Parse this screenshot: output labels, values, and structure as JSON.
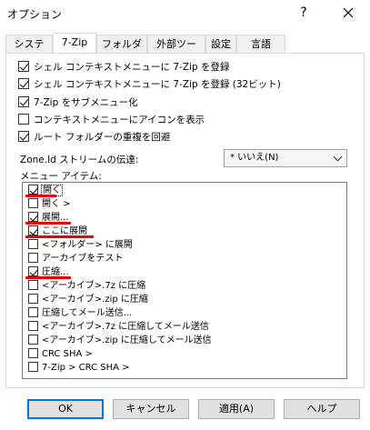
{
  "window": {
    "title": "オプション",
    "help_symbol": "?"
  },
  "tabs": [
    {
      "label": "システム",
      "active": false
    },
    {
      "label": "7-Zip",
      "active": true
    },
    {
      "label": "フォルダー",
      "active": false
    },
    {
      "label": "外部ツール",
      "active": false
    },
    {
      "label": "設定",
      "active": false
    },
    {
      "label": "言語",
      "active": false
    }
  ],
  "options": [
    {
      "label": "シェル コンテキストメニューに 7-Zip を登録",
      "checked": true
    },
    {
      "label": "シェル コンテキストメニューに 7-Zip を登録 (32ビット)",
      "checked": true
    },
    {
      "label": "7-Zip をサブメニュー化",
      "checked": true
    },
    {
      "label": "コンテキストメニューにアイコンを表示",
      "checked": false
    },
    {
      "label": "ルート フォルダーの重複を回避",
      "checked": true
    }
  ],
  "zone": {
    "label": "Zone.Id ストリームの伝達:",
    "value": "* いいえ(N)"
  },
  "menu_items_label": "メニュー アイテム:",
  "menu_items": [
    {
      "label": "開く",
      "checked": true
    },
    {
      "label": "開く >",
      "checked": false
    },
    {
      "label": "展開...",
      "checked": true
    },
    {
      "label": "ここに展開",
      "checked": true
    },
    {
      "label": "<フォルダー> に展開",
      "checked": false
    },
    {
      "label": "アーカイブをテスト",
      "checked": false
    },
    {
      "label": "圧縮...",
      "checked": true
    },
    {
      "label": "<アーカイブ>.7z に圧縮",
      "checked": false
    },
    {
      "label": "<アーカイブ>.zip に圧縮",
      "checked": false
    },
    {
      "label": "圧縮してメール送信...",
      "checked": false
    },
    {
      "label": "<アーカイブ>.7z に圧縮してメール送信",
      "checked": false
    },
    {
      "label": "<アーカイブ>.zip に圧縮してメール送信",
      "checked": false
    },
    {
      "label": "CRC SHA >",
      "checked": false
    },
    {
      "label": "7-Zip > CRC SHA >",
      "checked": false
    }
  ],
  "buttons": {
    "ok": "OK",
    "cancel": "キャンセル",
    "apply": "適用(A)",
    "help": "ヘルプ"
  },
  "colors": {
    "highlight_underline": "#e00000",
    "default_button_border": "#0078d7"
  }
}
